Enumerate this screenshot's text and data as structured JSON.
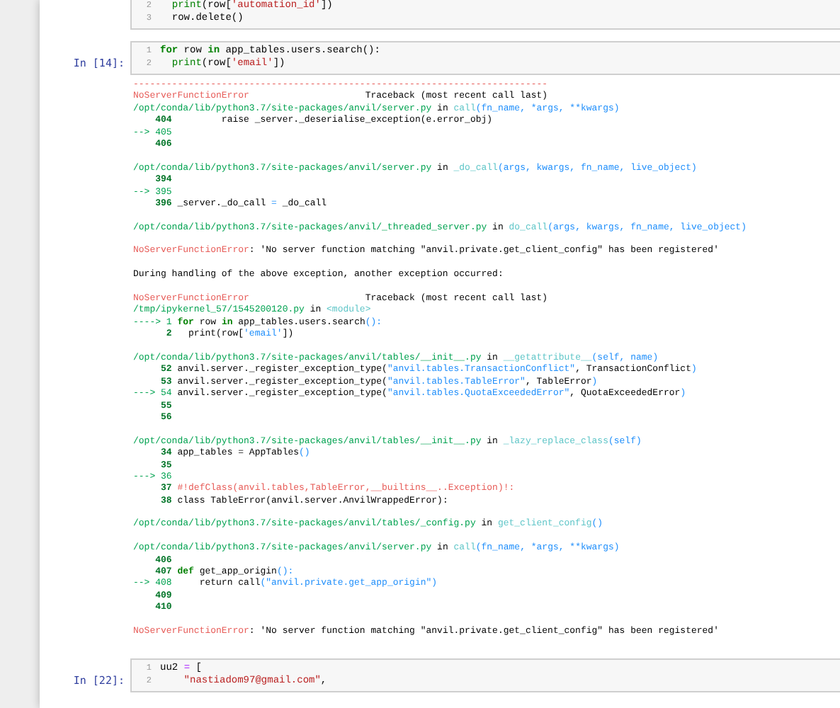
{
  "cells": [
    {
      "lines": [
        {
          "number": "2",
          "segments": [
            {
              "kind": "builtin",
              "text": "  print"
            },
            {
              "kind": "plain",
              "text": "(row["
            },
            {
              "kind": "string",
              "text": "'automation_id'"
            },
            {
              "kind": "plain",
              "text": "])"
            }
          ]
        },
        {
          "number": "3",
          "segments": [
            {
              "kind": "plain",
              "text": "  row.delete()"
            }
          ]
        }
      ]
    },
    {
      "prompt": "In [14]:",
      "lines": [
        {
          "number": "1",
          "segments": [
            {
              "kind": "keyword",
              "text": "for"
            },
            {
              "kind": "plain",
              "text": " row "
            },
            {
              "kind": "keyword",
              "text": "in"
            },
            {
              "kind": "plain",
              "text": " app_tables.users.search():"
            }
          ]
        },
        {
          "number": "2",
          "segments": [
            {
              "kind": "builtin",
              "text": "  print"
            },
            {
              "kind": "plain",
              "text": "(row["
            },
            {
              "kind": "string",
              "text": "'email'"
            },
            {
              "kind": "plain",
              "text": "])"
            }
          ]
        }
      ],
      "output": [
        [
          [
            {
              "kind": "error",
              "text": "---------------------------------------------------------------------------"
            }
          ],
          [
            {
              "kind": "error",
              "text": "NoServerFunctionError"
            },
            {
              "kind": "plain",
              "text": "                     Traceback (most recent call last)"
            }
          ],
          [
            {
              "kind": "path",
              "text": "/opt/conda/lib/python3.7/site-packages/anvil/server.py"
            },
            {
              "kind": "plain",
              "text": " in "
            },
            {
              "kind": "func",
              "text": "call"
            },
            {
              "kind": "args",
              "text": "(fn_name, *args, **kwargs)"
            }
          ],
          [
            {
              "kind": "lineno",
              "text": "    404"
            },
            {
              "kind": "plain",
              "text": "         raise _server._deserialise_exception(e.error_obj)"
            }
          ],
          [
            {
              "kind": "arrow",
              "text": "--> 405"
            }
          ],
          [
            {
              "kind": "lineno",
              "text": "    406"
            }
          ]
        ],
        [
          [
            {
              "kind": "path",
              "text": "/opt/conda/lib/python3.7/site-packages/anvil/server.py"
            },
            {
              "kind": "plain",
              "text": " in "
            },
            {
              "kind": "func",
              "text": "_do_call"
            },
            {
              "kind": "args",
              "text": "(args, kwargs, fn_name, live_object)"
            }
          ],
          [
            {
              "kind": "lineno",
              "text": "    394"
            }
          ],
          [
            {
              "kind": "arrow",
              "text": "--> 395"
            }
          ],
          [
            {
              "kind": "lineno",
              "text": "    396"
            },
            {
              "kind": "plain",
              "text": " _server._do_call "
            },
            {
              "kind": "args",
              "text": "="
            },
            {
              "kind": "plain",
              "text": " _do_call"
            }
          ]
        ],
        [
          [
            {
              "kind": "path",
              "text": "/opt/conda/lib/python3.7/site-packages/anvil/_threaded_server.py"
            },
            {
              "kind": "plain",
              "text": " in "
            },
            {
              "kind": "func",
              "text": "do_call"
            },
            {
              "kind": "args",
              "text": "(args, kwargs, fn_name, live_object)"
            }
          ]
        ],
        [
          [
            {
              "kind": "error",
              "text": "NoServerFunctionError"
            },
            {
              "kind": "plain",
              "text": ": 'No server function matching \"anvil.private.get_client_config\" has been registered'"
            }
          ]
        ],
        [
          [
            {
              "kind": "plain",
              "text": "During handling of the above exception, another exception occurred:"
            }
          ]
        ],
        [
          [
            {
              "kind": "error",
              "text": "NoServerFunctionError"
            },
            {
              "kind": "plain",
              "text": "                     Traceback (most recent call last)"
            }
          ],
          [
            {
              "kind": "path",
              "text": "/tmp/ipykernel_57/1545200120.py"
            },
            {
              "kind": "plain",
              "text": " in "
            },
            {
              "kind": "func",
              "text": "<module>"
            }
          ],
          [
            {
              "kind": "arrow",
              "text": "----> 1"
            },
            {
              "kind": "keyword",
              "text": " for"
            },
            {
              "kind": "plain",
              "text": " row "
            },
            {
              "kind": "keyword",
              "text": "in"
            },
            {
              "kind": "plain",
              "text": " app_tables.users.search"
            },
            {
              "kind": "args",
              "text": "():"
            }
          ],
          [
            {
              "kind": "lineno",
              "text": "      2"
            },
            {
              "kind": "plain",
              "text": "   print(row["
            },
            {
              "kind": "args",
              "text": "'email'"
            },
            {
              "kind": "plain",
              "text": "])"
            }
          ]
        ],
        [
          [
            {
              "kind": "path",
              "text": "/opt/conda/lib/python3.7/site-packages/anvil/tables/__init__.py"
            },
            {
              "kind": "plain",
              "text": " in "
            },
            {
              "kind": "func",
              "text": "__getattribute__"
            },
            {
              "kind": "args",
              "text": "(self, name)"
            }
          ],
          [
            {
              "kind": "lineno",
              "text": "     52"
            },
            {
              "kind": "plain",
              "text": " anvil.server._register_exception_type("
            },
            {
              "kind": "args",
              "text": "\"anvil.tables.TransactionConflict\""
            },
            {
              "kind": "plain",
              "text": ", TransactionConflict"
            },
            {
              "kind": "args",
              "text": ")"
            }
          ],
          [
            {
              "kind": "lineno",
              "text": "     53"
            },
            {
              "kind": "plain",
              "text": " anvil.server._register_exception_type("
            },
            {
              "kind": "args",
              "text": "\"anvil.tables.TableError\""
            },
            {
              "kind": "plain",
              "text": ", TableError"
            },
            {
              "kind": "args",
              "text": ")"
            }
          ],
          [
            {
              "kind": "arrow",
              "text": "---> 54"
            },
            {
              "kind": "plain",
              "text": " anvil.server._register_exception_type("
            },
            {
              "kind": "args",
              "text": "\"anvil.tables.QuotaExceededError\""
            },
            {
              "kind": "plain",
              "text": ", QuotaExceededError"
            },
            {
              "kind": "args",
              "text": ")"
            }
          ],
          [
            {
              "kind": "lineno",
              "text": "     55"
            }
          ],
          [
            {
              "kind": "lineno",
              "text": "     56"
            }
          ]
        ],
        [
          [
            {
              "kind": "path",
              "text": "/opt/conda/lib/python3.7/site-packages/anvil/tables/__init__.py"
            },
            {
              "kind": "plain",
              "text": " in "
            },
            {
              "kind": "func",
              "text": "_lazy_replace_class"
            },
            {
              "kind": "args",
              "text": "(self)"
            }
          ],
          [
            {
              "kind": "lineno",
              "text": "     34"
            },
            {
              "kind": "plain",
              "text": " app_tables = AppTables"
            },
            {
              "kind": "args",
              "text": "()"
            }
          ],
          [
            {
              "kind": "lineno",
              "text": "     35"
            }
          ],
          [
            {
              "kind": "arrow",
              "text": "---> 36"
            }
          ],
          [
            {
              "kind": "lineno",
              "text": "     37"
            },
            {
              "kind": "error",
              "text": " #!defClass(anvil.tables,TableError,__builtins__..Exception)!:"
            }
          ],
          [
            {
              "kind": "lineno",
              "text": "     38"
            },
            {
              "kind": "plain",
              "text": " class TableError(anvil.server.AnvilWrappedError):"
            }
          ]
        ],
        [
          [
            {
              "kind": "path",
              "text": "/opt/conda/lib/python3.7/site-packages/anvil/tables/_config.py"
            },
            {
              "kind": "plain",
              "text": " in "
            },
            {
              "kind": "func",
              "text": "get_client_config"
            },
            {
              "kind": "args",
              "text": "()"
            }
          ]
        ],
        [
          [
            {
              "kind": "path",
              "text": "/opt/conda/lib/python3.7/site-packages/anvil/server.py"
            },
            {
              "kind": "plain",
              "text": " in "
            },
            {
              "kind": "func",
              "text": "call"
            },
            {
              "kind": "args",
              "text": "(fn_name, *args, **kwargs)"
            }
          ],
          [
            {
              "kind": "lineno",
              "text": "    406"
            }
          ],
          [
            {
              "kind": "lineno",
              "text": "    407"
            },
            {
              "kind": "keyword",
              "text": " def"
            },
            {
              "kind": "plain",
              "text": " get_app_origin"
            },
            {
              "kind": "args",
              "text": "():"
            }
          ],
          [
            {
              "kind": "arrow",
              "text": "--> 408"
            },
            {
              "kind": "plain",
              "text": "     return call"
            },
            {
              "kind": "args",
              "text": "(\"anvil.private.get_app_origin\")"
            }
          ],
          [
            {
              "kind": "lineno",
              "text": "    409"
            }
          ],
          [
            {
              "kind": "lineno",
              "text": "    410"
            }
          ]
        ],
        [
          [
            {
              "kind": "error",
              "text": "NoServerFunctionError"
            },
            {
              "kind": "plain",
              "text": ": 'No server function matching \"anvil.private.get_client_config\" has been registered'"
            }
          ]
        ]
      ]
    },
    {
      "prompt": "In [22]:",
      "lines": [
        {
          "number": "1",
          "segments": [
            {
              "kind": "plain",
              "text": "uu2 "
            },
            {
              "kind": "operator",
              "text": "="
            },
            {
              "kind": "plain",
              "text": " ["
            }
          ]
        },
        {
          "number": "2",
          "segments": [
            {
              "kind": "string",
              "text": "    \"nastiadom97@gmail.com\""
            },
            {
              "kind": "plain",
              "text": ","
            }
          ]
        }
      ]
    }
  ]
}
